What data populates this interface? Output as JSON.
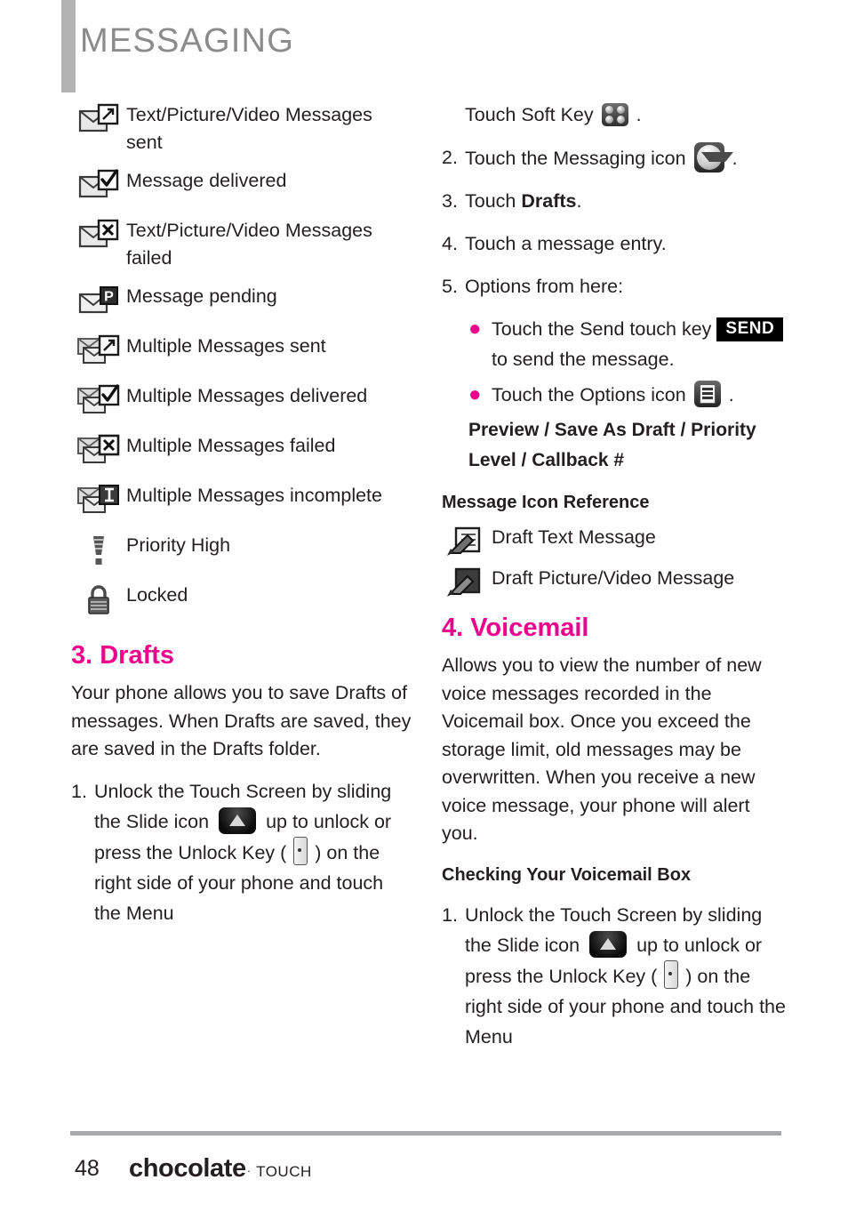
{
  "header": {
    "title": "MESSAGING",
    "accent_color": "#b3b3b3",
    "title_color": "#8b8b8b"
  },
  "theme": {
    "heading_pink": "#ec008c",
    "body_black": "#231f20",
    "rule_gray": "#a7a9ac"
  },
  "left_column": {
    "icon_legend": [
      {
        "icon": "envelope-arrow-sent-icon",
        "label": "Text/Picture/Video Messages sent"
      },
      {
        "icon": "envelope-check-delivered-icon",
        "label": "Message delivered"
      },
      {
        "icon": "envelope-x-failed-icon",
        "label": "Text/Picture/Video Messages failed"
      },
      {
        "icon": "envelope-p-pending-icon",
        "label": "Message pending"
      },
      {
        "icon": "multi-envelope-arrow-sent-icon",
        "label": "Multiple Messages sent"
      },
      {
        "icon": "multi-envelope-check-delivered-icon",
        "label": "Multiple Messages delivered"
      },
      {
        "icon": "multi-envelope-x-failed-icon",
        "label": "Multiple Messages failed"
      },
      {
        "icon": "multi-envelope-incomplete-icon",
        "label": "Multiple Messages incomplete"
      },
      {
        "icon": "priority-high-icon",
        "label": "Priority High"
      },
      {
        "icon": "lock-icon",
        "label": "Locked"
      }
    ],
    "drafts_section": {
      "heading": "3. Drafts",
      "intro": "Your phone allows you to save Drafts of messages. When Drafts are saved, they are saved in the Drafts folder.",
      "step_1": {
        "marker": "1.",
        "part_a": "Unlock the Touch Screen by sliding the Slide icon",
        "part_b": "up to unlock or press the Unlock Key (",
        "part_c": ") on the right side of your phone and touch the Menu"
      }
    }
  },
  "right_column": {
    "steps_continued": {
      "step_1_tail": "Touch Soft Key",
      "step_1_tail_end": ".",
      "step_2": {
        "marker": "2.",
        "text_a": "Touch the Messaging icon",
        "text_b": "."
      },
      "step_3": {
        "marker": "3.",
        "text_a": "Touch ",
        "bold": "Drafts",
        "text_b": "."
      },
      "step_4": {
        "marker": "4.",
        "text": "Touch a message entry."
      },
      "step_5": {
        "marker": "5.",
        "text": "Options from here:"
      }
    },
    "bullets": [
      {
        "text_a": "Touch the Send touch key",
        "badge": "SEND",
        "text_b": "to send the message."
      },
      {
        "text_a": "Touch the Options icon",
        "text_b": "."
      }
    ],
    "options_emphasis": "Preview / Save As Draft / Priority Level / Callback #",
    "message_icon_reference": {
      "heading": "Message Icon Reference",
      "items": [
        {
          "icon": "draft-text-message-icon",
          "label": "Draft Text Message"
        },
        {
          "icon": "draft-picture-video-message-icon",
          "label": "Draft Picture/Video Message"
        }
      ]
    },
    "voicemail_section": {
      "heading": "4. Voicemail",
      "intro": "Allows you to view the number of new voice messages recorded in the Voicemail box. Once you exceed the storage limit, old messages may be overwritten. When you receive a new voice message, your phone will alert you.",
      "subhead": "Checking Your Voicemail Box",
      "step_1": {
        "marker": "1.",
        "part_a": "Unlock the Touch Screen by sliding the Slide icon",
        "part_b": "up to unlock or press the Unlock Key (",
        "part_c": ") on the right side of your phone and touch the Menu"
      }
    }
  },
  "footer": {
    "page_number": "48",
    "brand_name": "chocolate",
    "brand_registered": "·",
    "brand_sub": "TOUCH"
  }
}
